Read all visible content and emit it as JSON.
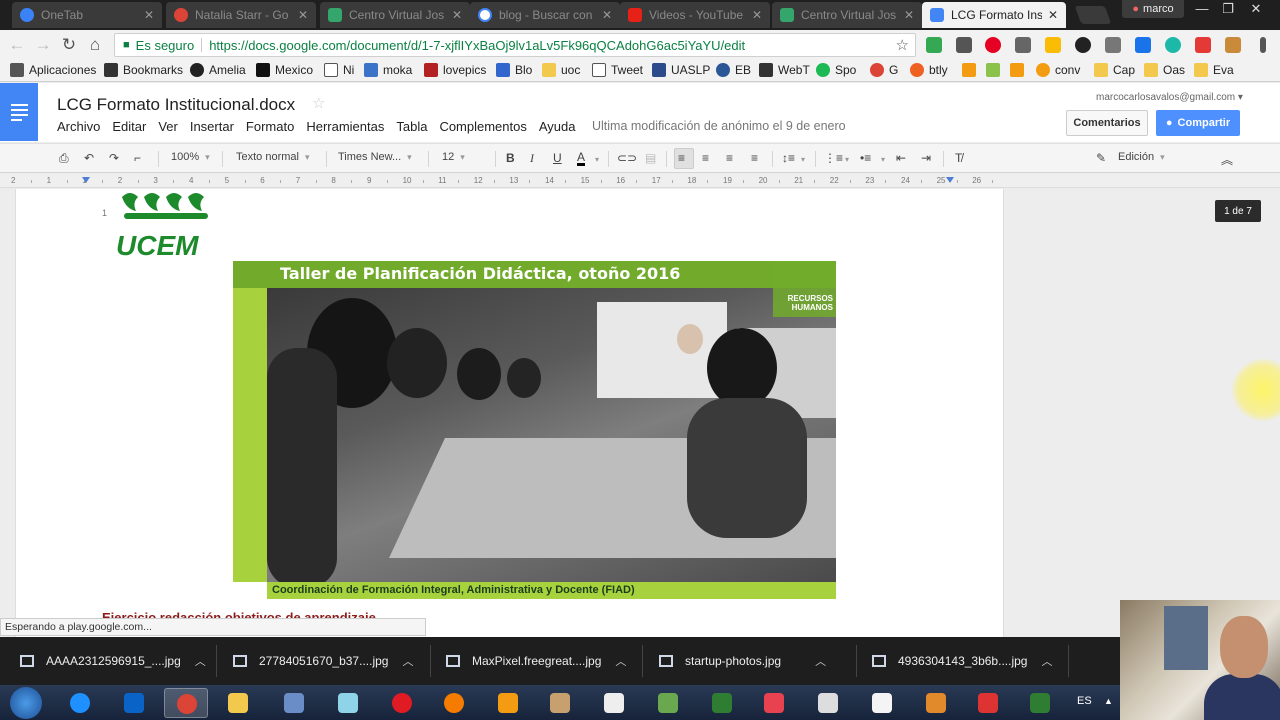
{
  "browser": {
    "tabs": [
      {
        "title": "OneTab",
        "color": "#3b82f6",
        "active": false
      },
      {
        "title": "Natalia Starr - Go",
        "color": "#db4437",
        "active": false
      },
      {
        "title": "Centro Virtual Jos",
        "color": "#35a66b",
        "active": false
      },
      {
        "title": "blog - Buscar con",
        "color": "#ffffff",
        "active": false
      },
      {
        "title": "Videos - YouTube",
        "color": "#e62117",
        "active": false
      },
      {
        "title": "Centro Virtual Jos",
        "color": "#35a66b",
        "active": false
      },
      {
        "title": "LCG Formato Instit",
        "color": "#4285f4",
        "active": true
      }
    ],
    "tab_close": "✕",
    "profile": "marco",
    "window_controls": [
      "—",
      "❐",
      "✕"
    ],
    "secure_label": "Es seguro",
    "url": "https://docs.google.com/document/d/1-7-xjflIYxBaOj9lv1aLv5Fk96qQCAdohG6ac5iYaYU/edit",
    "bookmarks": [
      {
        "label": "Aplicaciones",
        "color": "#555555"
      },
      {
        "label": "Bookmarks",
        "color": "#333333"
      },
      {
        "label": "Amelia",
        "color": "#222222"
      },
      {
        "label": "Mexico",
        "color": "#111111"
      },
      {
        "label": "Ni",
        "color": "#ffffff"
      },
      {
        "label": "moka",
        "color": "#3b73c8"
      },
      {
        "label": "lovepics",
        "color": "#b22222"
      },
      {
        "label": "Blo",
        "color": "#3366cc"
      },
      {
        "label": "uoc",
        "color": "#f2c94c"
      },
      {
        "label": "Tweet",
        "color": "#ffffff"
      },
      {
        "label": "UASLP",
        "color": "#2d4a8a"
      },
      {
        "label": "EB",
        "color": "#2b5797"
      },
      {
        "label": "WebT",
        "color": "#333333"
      },
      {
        "label": "Spo",
        "color": "#1db954"
      },
      {
        "label": "G",
        "color": "#db4437"
      },
      {
        "label": "btly",
        "color": "#ee6123"
      },
      {
        "label": "conv",
        "color": "#f39c12"
      },
      {
        "label": "Cap",
        "color": "#f2c94c"
      },
      {
        "label": "Oas",
        "color": "#f2c94c"
      },
      {
        "label": "Eva",
        "color": "#f2c94c"
      }
    ]
  },
  "docs": {
    "title": "LCG Formato Institucional.docx",
    "menu": [
      "Archivo",
      "Editar",
      "Ver",
      "Insertar",
      "Formato",
      "Herramientas",
      "Tabla",
      "Complementos",
      "Ayuda"
    ],
    "last_modified": "Ultima modificación de anónimo el 9 de enero",
    "account_email": "marcocarlosavalos@gmail.com",
    "comments_button": "Comentarios",
    "share_button": "Compartir",
    "accent": "#4285f4",
    "toolbar": {
      "zoom": "100%",
      "style": "Texto normal",
      "font": "Times New...",
      "size": "12",
      "mode": "Edición"
    },
    "ruler_numbers": [
      "2",
      "1",
      "1",
      "2",
      "3",
      "4",
      "5",
      "6",
      "7",
      "8",
      "9",
      "10",
      "11",
      "12",
      "13",
      "14",
      "15",
      "16",
      "17",
      "18",
      "19",
      "20",
      "21",
      "22",
      "23",
      "24",
      "25",
      "26"
    ],
    "line_number": "1",
    "logo_text": "UCEM",
    "banner": {
      "title": "Taller de Planificación Didáctica, otoño 2016",
      "watermark": "RECURSOS HUMANOS",
      "caption": "Coordinación de Formación Integral, Administrativa y Docente (FIAD)"
    },
    "exercise_heading": "Ejercicio redacción objetivos de aprendizaje",
    "page_count": "1 de 7"
  },
  "status_text": "Esperando a play.google.com...",
  "downloads": [
    {
      "name": "AAAA2312596915_....jpg"
    },
    {
      "name": "27784051670_b37....jpg"
    },
    {
      "name": "MaxPixel.freegreat....jpg"
    },
    {
      "name": "startup-photos.jpg"
    },
    {
      "name": "4936304143_3b6b....jpg"
    }
  ],
  "taskbar": {
    "language": "ES",
    "apps": [
      {
        "name": "internet-explorer",
        "color": "#1e90ff"
      },
      {
        "name": "outlook",
        "color": "#0a64c8"
      },
      {
        "name": "chrome",
        "color": "#db4437"
      },
      {
        "name": "explorer",
        "color": "#f2c94c"
      },
      {
        "name": "app-5",
        "color": "#6a8cc7"
      },
      {
        "name": "app-6",
        "color": "#8fd3e8"
      },
      {
        "name": "opera",
        "color": "#e01b24"
      },
      {
        "name": "firefox",
        "color": "#f57c00"
      },
      {
        "name": "app-9",
        "color": "#f39c12"
      },
      {
        "name": "app-10",
        "color": "#c8a070"
      },
      {
        "name": "app-11",
        "color": "#eeeeee"
      },
      {
        "name": "app-12",
        "color": "#6aa84f"
      },
      {
        "name": "camtasia",
        "color": "#2e7d32"
      },
      {
        "name": "app-14",
        "color": "#e8414f"
      },
      {
        "name": "app-15",
        "color": "#dddddd"
      },
      {
        "name": "app-16",
        "color": "#f4f4f4"
      },
      {
        "name": "app-17",
        "color": "#e08a2c"
      },
      {
        "name": "app-18",
        "color": "#d33"
      },
      {
        "name": "camtasia-2",
        "color": "#2e7d32"
      }
    ]
  }
}
